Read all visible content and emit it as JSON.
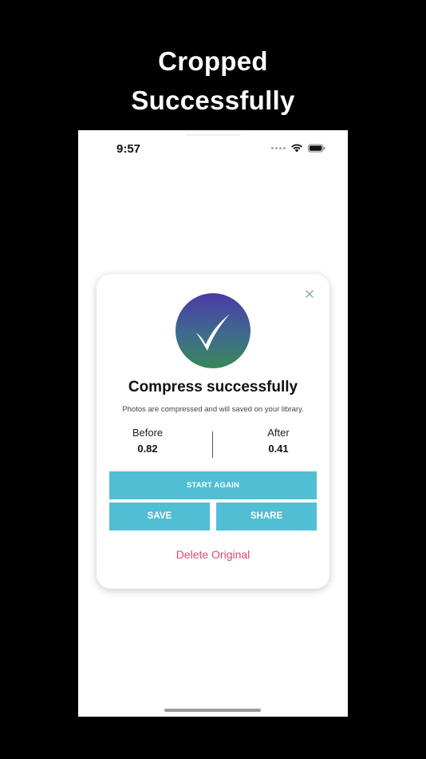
{
  "headline": {
    "line1": "Cropped",
    "line2": "Successfully"
  },
  "status_bar": {
    "time": "9:57",
    "icons": [
      "signal-dots-icon",
      "wifi-icon",
      "battery-icon"
    ]
  },
  "dialog": {
    "close_icon": "close-icon",
    "badge_icon": "checkmark-icon",
    "title": "Compress successfully",
    "subtitle": "Photos are compressed and will saved on your library.",
    "before_label": "Before",
    "before_value": "0.82",
    "after_label": "After",
    "after_value": "0.41",
    "start_again_label": "START AGAIN",
    "save_label": "SAVE",
    "share_label": "SHARE",
    "delete_label": "Delete Original"
  },
  "colors": {
    "background": "#000000",
    "button": "#52bed4",
    "delete": "#e6466c",
    "badge_top": "#4b3ba6",
    "badge_bottom": "#3a8659"
  }
}
